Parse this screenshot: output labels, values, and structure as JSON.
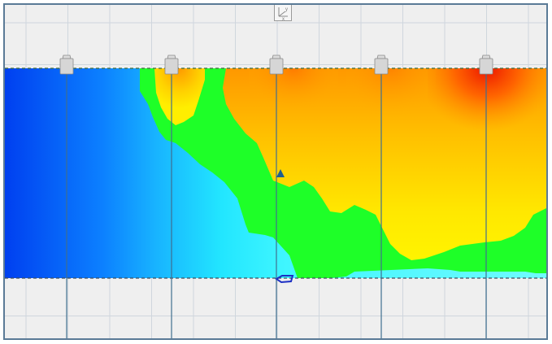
{
  "viewer": {
    "background_color": "#efefef",
    "grid_color": "#cfd6dd",
    "frame_color": "#5a7a96"
  },
  "axis_indicator": {
    "icon": "axis-triad-icon",
    "labels": {
      "y": "y",
      "z": "z",
      "x": "x"
    }
  },
  "sensors": {
    "icon": "sensor-probe-icon",
    "count": 5,
    "line_color": "#3f6f8f"
  },
  "cursor_marker": {
    "icon": "up-arrow-marker-icon",
    "color": "#1f5f8f"
  },
  "origin_marker": {
    "icon": "origin-pointer-icon",
    "color": "#1c2fc4"
  },
  "colormap": {
    "low": "#0044ff",
    "mid_low": "#00f0ff",
    "band": "#1eff28",
    "mid_high": "#ffe600",
    "high": "#ee1c00"
  }
}
